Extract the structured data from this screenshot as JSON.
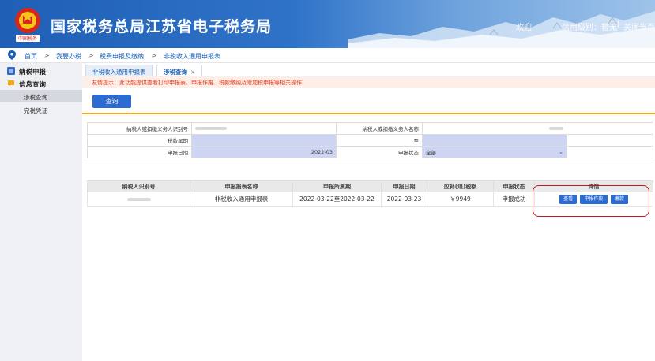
{
  "header": {
    "site_title": "国家税务总局江苏省电子税务局",
    "welcome": "欢迎",
    "credit_level": "信用级别：暂无",
    "separator": "|",
    "close_page": "关闭当页",
    "emblem_caption": "中国税务",
    "colors": {
      "start": "#1f5fb5",
      "end": "#9ec3ea"
    }
  },
  "breadcrumb": {
    "items": [
      "首页",
      "我要办税",
      "税费申报及缴纳",
      "非税收入通用申报表"
    ],
    "separator": ">"
  },
  "sidebar": {
    "groups": [
      {
        "label": "纳税申报",
        "icon": "list-icon"
      },
      {
        "label": "信息查询",
        "icon": "chat-icon"
      }
    ],
    "items": [
      {
        "label": "涉税查询",
        "active": true
      },
      {
        "label": "完税凭证",
        "active": false
      }
    ]
  },
  "tabs": [
    {
      "label": "非税收入通用申报表",
      "active": false
    },
    {
      "label": "涉税查询",
      "active": true,
      "close": "×"
    }
  ],
  "notice": "友情提示：此功能提供查看打印申报表、申报作废、税款缴纳及附加税申报等相关操作!",
  "query_button": "查询",
  "form": {
    "taxpayer_id_label": "纳税人或扣缴义务人识别号",
    "taxpayer_name_label": "纳税人或扣缴义务人名称",
    "tax_period_label": "税款属期",
    "to_label": "至",
    "filing_date_label": "申报日期",
    "filing_date_value": "2022-03",
    "filing_status_label": "申报状态",
    "filing_status_value": "全部"
  },
  "results": {
    "headers": [
      "纳税人识别号",
      "申报报表名称",
      "申报所属期",
      "申报日期",
      "应补(退)税额",
      "申报状态",
      "详情"
    ],
    "rows": [
      {
        "report_name": "非税收入通用申报表",
        "period": "2022-03-22至2022-03-22",
        "filing_date": "2022-03-23",
        "amount": "￥9949",
        "status": "申报成功",
        "actions": [
          "查看",
          "申报作废",
          "缴款"
        ]
      }
    ]
  },
  "accent_color": "#2c6bd1",
  "highlight_color": "#c0171c"
}
